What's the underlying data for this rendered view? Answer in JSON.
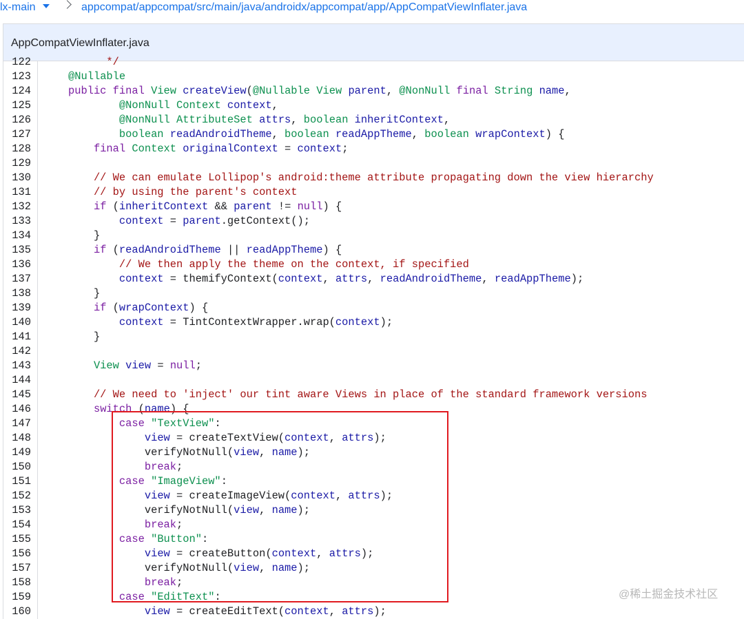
{
  "breadcrumb": {
    "branch": "lx-main",
    "path": "appcompat/appcompat/src/main/java/androidx/appcompat/app/AppCompatViewInflater.java"
  },
  "file": {
    "name": "AppCompatViewInflater.java"
  },
  "code_lines": [
    {
      "n": "122",
      "tokens": [
        [
          "      */",
          "cm"
        ]
      ]
    },
    {
      "n": "123",
      "tokens": [
        [
          "@",
          "an"
        ],
        [
          "Nullable",
          "ty"
        ]
      ]
    },
    {
      "n": "124",
      "tokens": [
        [
          "public final ",
          "kw"
        ],
        [
          "View ",
          "ty"
        ],
        [
          "createView",
          "fn"
        ],
        [
          "(",
          "p"
        ],
        [
          "@",
          "an"
        ],
        [
          "Nullable ",
          "ty"
        ],
        [
          "View ",
          "ty"
        ],
        [
          "parent",
          "var"
        ],
        [
          ", ",
          "p"
        ],
        [
          "@",
          "an"
        ],
        [
          "NonNull ",
          "ty"
        ],
        [
          "final ",
          "kw"
        ],
        [
          "String ",
          "ty"
        ],
        [
          "name",
          "var"
        ],
        [
          ",",
          "p"
        ]
      ]
    },
    {
      "n": "125",
      "tokens": [
        [
          "        ",
          "p"
        ],
        [
          "@",
          "an"
        ],
        [
          "NonNull ",
          "ty"
        ],
        [
          "Context ",
          "ty"
        ],
        [
          "context",
          "var"
        ],
        [
          ",",
          "p"
        ]
      ]
    },
    {
      "n": "126",
      "tokens": [
        [
          "        ",
          "p"
        ],
        [
          "@",
          "an"
        ],
        [
          "NonNull ",
          "ty"
        ],
        [
          "AttributeSet ",
          "ty"
        ],
        [
          "attrs",
          "var"
        ],
        [
          ", ",
          "p"
        ],
        [
          "boolean ",
          "ty"
        ],
        [
          "inheritContext",
          "var"
        ],
        [
          ",",
          "p"
        ]
      ]
    },
    {
      "n": "127",
      "tokens": [
        [
          "        ",
          "p"
        ],
        [
          "boolean ",
          "ty"
        ],
        [
          "readAndroidTheme",
          "var"
        ],
        [
          ", ",
          "p"
        ],
        [
          "boolean ",
          "ty"
        ],
        [
          "readAppTheme",
          "var"
        ],
        [
          ", ",
          "p"
        ],
        [
          "boolean ",
          "ty"
        ],
        [
          "wrapContext",
          "var"
        ],
        [
          ") {",
          "p"
        ]
      ]
    },
    {
      "n": "128",
      "tokens": [
        [
          "    ",
          "p"
        ],
        [
          "final ",
          "kw"
        ],
        [
          "Context ",
          "ty"
        ],
        [
          "originalContext",
          "var"
        ],
        [
          " = ",
          "p"
        ],
        [
          "context",
          "var"
        ],
        [
          ";",
          "p"
        ]
      ]
    },
    {
      "n": "129",
      "tokens": []
    },
    {
      "n": "130",
      "tokens": [
        [
          "    // We can emulate Lollipop's android:theme attribute propagating down the view hierarchy",
          "cm"
        ]
      ]
    },
    {
      "n": "131",
      "tokens": [
        [
          "    // by using the parent's context",
          "cm"
        ]
      ]
    },
    {
      "n": "132",
      "tokens": [
        [
          "    ",
          "p"
        ],
        [
          "if ",
          "kw"
        ],
        [
          "(",
          "p"
        ],
        [
          "inheritContext",
          "var"
        ],
        [
          " && ",
          "p"
        ],
        [
          "parent",
          "var"
        ],
        [
          " != ",
          "p"
        ],
        [
          "null",
          "kw"
        ],
        [
          ") {",
          "p"
        ]
      ]
    },
    {
      "n": "133",
      "tokens": [
        [
          "        ",
          "p"
        ],
        [
          "context",
          "var"
        ],
        [
          " = ",
          "p"
        ],
        [
          "parent",
          "var"
        ],
        [
          ".getContext();",
          "p"
        ]
      ]
    },
    {
      "n": "134",
      "tokens": [
        [
          "    }",
          "p"
        ]
      ]
    },
    {
      "n": "135",
      "tokens": [
        [
          "    ",
          "p"
        ],
        [
          "if ",
          "kw"
        ],
        [
          "(",
          "p"
        ],
        [
          "readAndroidTheme",
          "var"
        ],
        [
          " || ",
          "p"
        ],
        [
          "readAppTheme",
          "var"
        ],
        [
          ") {",
          "p"
        ]
      ]
    },
    {
      "n": "136",
      "tokens": [
        [
          "        // We then apply the theme on the context, if specified",
          "cm"
        ]
      ]
    },
    {
      "n": "137",
      "tokens": [
        [
          "        ",
          "p"
        ],
        [
          "context",
          "var"
        ],
        [
          " = themifyContext(",
          "p"
        ],
        [
          "context",
          "var"
        ],
        [
          ", ",
          "p"
        ],
        [
          "attrs",
          "var"
        ],
        [
          ", ",
          "p"
        ],
        [
          "readAndroidTheme",
          "var"
        ],
        [
          ", ",
          "p"
        ],
        [
          "readAppTheme",
          "var"
        ],
        [
          ");",
          "p"
        ]
      ]
    },
    {
      "n": "138",
      "tokens": [
        [
          "    }",
          "p"
        ]
      ]
    },
    {
      "n": "139",
      "tokens": [
        [
          "    ",
          "p"
        ],
        [
          "if ",
          "kw"
        ],
        [
          "(",
          "p"
        ],
        [
          "wrapContext",
          "var"
        ],
        [
          ") {",
          "p"
        ]
      ]
    },
    {
      "n": "140",
      "tokens": [
        [
          "        ",
          "p"
        ],
        [
          "context",
          "var"
        ],
        [
          " = TintContextWrapper.wrap(",
          "p"
        ],
        [
          "context",
          "var"
        ],
        [
          ");",
          "p"
        ]
      ]
    },
    {
      "n": "141",
      "tokens": [
        [
          "    }",
          "p"
        ]
      ]
    },
    {
      "n": "142",
      "tokens": []
    },
    {
      "n": "143",
      "tokens": [
        [
          "    ",
          "p"
        ],
        [
          "View ",
          "ty"
        ],
        [
          "view",
          "var"
        ],
        [
          " = ",
          "p"
        ],
        [
          "null",
          "kw"
        ],
        [
          ";",
          "p"
        ]
      ]
    },
    {
      "n": "144",
      "tokens": []
    },
    {
      "n": "145",
      "tokens": [
        [
          "    // We need to 'inject' our tint aware Views in place of the standard framework versions",
          "cm"
        ]
      ]
    },
    {
      "n": "146",
      "tokens": [
        [
          "    ",
          "p"
        ],
        [
          "switch ",
          "kw"
        ],
        [
          "(",
          "p"
        ],
        [
          "name",
          "var"
        ],
        [
          ") {",
          "p"
        ]
      ]
    },
    {
      "n": "147",
      "tokens": [
        [
          "        ",
          "p"
        ],
        [
          "case ",
          "kw"
        ],
        [
          "\"TextView\"",
          "str"
        ],
        [
          ":",
          "p"
        ]
      ]
    },
    {
      "n": "148",
      "tokens": [
        [
          "            ",
          "p"
        ],
        [
          "view",
          "var"
        ],
        [
          " = createTextView(",
          "p"
        ],
        [
          "context",
          "var"
        ],
        [
          ", ",
          "p"
        ],
        [
          "attrs",
          "var"
        ],
        [
          ");",
          "p"
        ]
      ]
    },
    {
      "n": "149",
      "tokens": [
        [
          "            verifyNotNull(",
          "p"
        ],
        [
          "view",
          "var"
        ],
        [
          ", ",
          "p"
        ],
        [
          "name",
          "var"
        ],
        [
          ");",
          "p"
        ]
      ]
    },
    {
      "n": "150",
      "tokens": [
        [
          "            ",
          "p"
        ],
        [
          "break",
          "kw"
        ],
        [
          ";",
          "p"
        ]
      ]
    },
    {
      "n": "151",
      "tokens": [
        [
          "        ",
          "p"
        ],
        [
          "case ",
          "kw"
        ],
        [
          "\"ImageView\"",
          "str"
        ],
        [
          ":",
          "p"
        ]
      ]
    },
    {
      "n": "152",
      "tokens": [
        [
          "            ",
          "p"
        ],
        [
          "view",
          "var"
        ],
        [
          " = createImageView(",
          "p"
        ],
        [
          "context",
          "var"
        ],
        [
          ", ",
          "p"
        ],
        [
          "attrs",
          "var"
        ],
        [
          ");",
          "p"
        ]
      ]
    },
    {
      "n": "153",
      "tokens": [
        [
          "            verifyNotNull(",
          "p"
        ],
        [
          "view",
          "var"
        ],
        [
          ", ",
          "p"
        ],
        [
          "name",
          "var"
        ],
        [
          ");",
          "p"
        ]
      ]
    },
    {
      "n": "154",
      "tokens": [
        [
          "            ",
          "p"
        ],
        [
          "break",
          "kw"
        ],
        [
          ";",
          "p"
        ]
      ]
    },
    {
      "n": "155",
      "tokens": [
        [
          "        ",
          "p"
        ],
        [
          "case ",
          "kw"
        ],
        [
          "\"Button\"",
          "str"
        ],
        [
          ":",
          "p"
        ]
      ]
    },
    {
      "n": "156",
      "tokens": [
        [
          "            ",
          "p"
        ],
        [
          "view",
          "var"
        ],
        [
          " = createButton(",
          "p"
        ],
        [
          "context",
          "var"
        ],
        [
          ", ",
          "p"
        ],
        [
          "attrs",
          "var"
        ],
        [
          ");",
          "p"
        ]
      ]
    },
    {
      "n": "157",
      "tokens": [
        [
          "            verifyNotNull(",
          "p"
        ],
        [
          "view",
          "var"
        ],
        [
          ", ",
          "p"
        ],
        [
          "name",
          "var"
        ],
        [
          ");",
          "p"
        ]
      ]
    },
    {
      "n": "158",
      "tokens": [
        [
          "            ",
          "p"
        ],
        [
          "break",
          "kw"
        ],
        [
          ";",
          "p"
        ]
      ]
    },
    {
      "n": "159",
      "tokens": [
        [
          "        ",
          "p"
        ],
        [
          "case ",
          "kw"
        ],
        [
          "\"EditText\"",
          "str"
        ],
        [
          ":",
          "p"
        ]
      ]
    },
    {
      "n": "160",
      "tokens": [
        [
          "            ",
          "p"
        ],
        [
          "view",
          "var"
        ],
        [
          " = createEditText(",
          "p"
        ],
        [
          "context",
          "var"
        ],
        [
          ", ",
          "p"
        ],
        [
          "attrs",
          "var"
        ],
        [
          ");",
          "p"
        ]
      ]
    }
  ],
  "watermark": "@稀土掘金技术社区",
  "colors": {
    "accent": "#1a73e8",
    "header_bg": "#e8f0fe",
    "highlight_border": "#e0191f",
    "keyword": "#7b1fa2",
    "type": "#0d904f",
    "variable": "#1a1aa6",
    "comment": "#a31515"
  }
}
